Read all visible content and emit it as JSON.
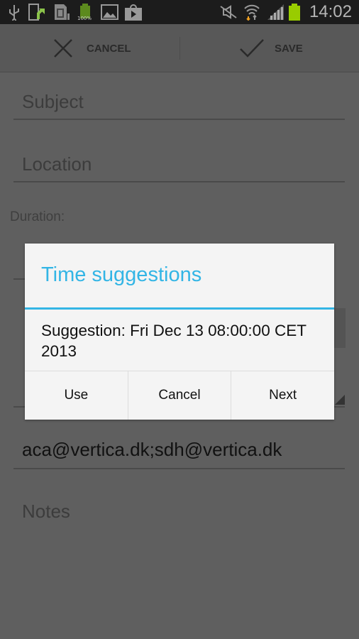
{
  "status_bar": {
    "time": "14:02",
    "battery_label": "100%",
    "icons": [
      "usb-icon",
      "phone-update-icon",
      "sd-card-icon",
      "battery-full-icon",
      "image-icon",
      "play-store-icon",
      "mute-icon",
      "wifi-icon",
      "signal-icon",
      "battery-icon"
    ]
  },
  "action_bar": {
    "cancel_label": "CANCEL",
    "save_label": "SAVE"
  },
  "form": {
    "subject_placeholder": "Subject",
    "location_placeholder": "Location",
    "duration_label": "Duration:",
    "attendees_value": "aca@vertica.dk;sdh@vertica.dk",
    "notes_placeholder": "Notes"
  },
  "dialog": {
    "title": "Time suggestions",
    "message": "Suggestion: Fri Dec 13 08:00:00 CET 2013",
    "buttons": {
      "use": "Use",
      "cancel": "Cancel",
      "next": "Next"
    },
    "accent": "#33b5e5"
  }
}
